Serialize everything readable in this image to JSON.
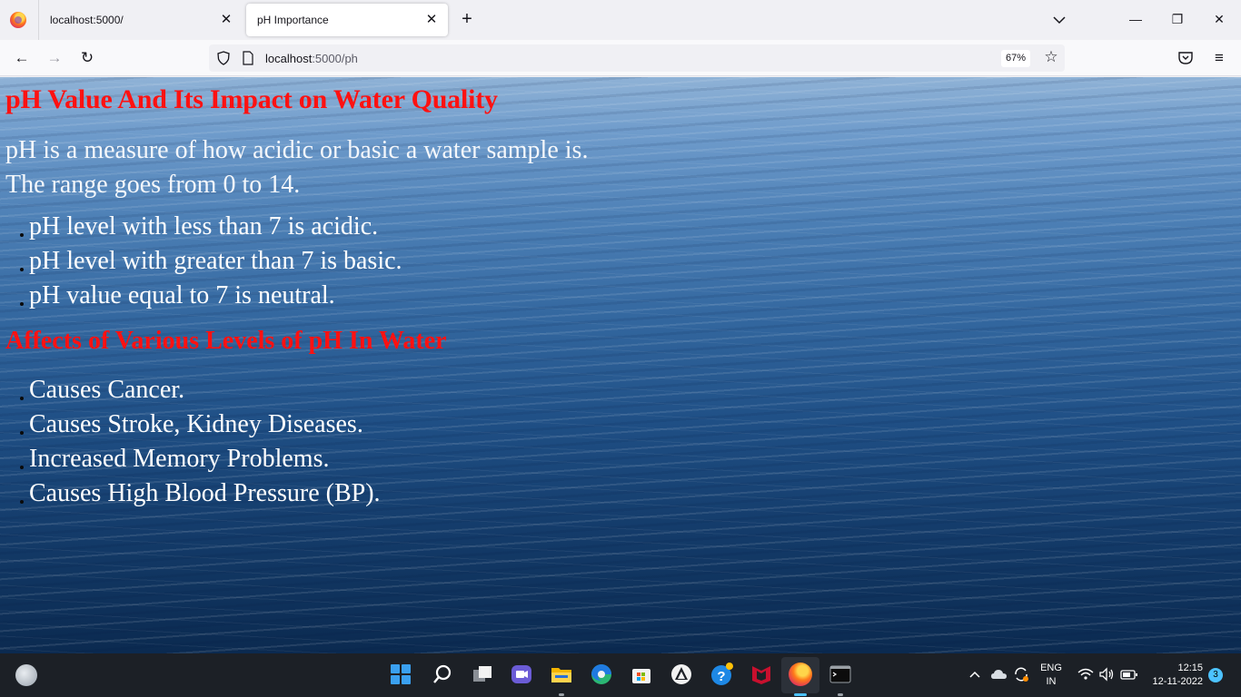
{
  "browser": {
    "tabs": [
      {
        "title": "localhost:5000/",
        "active": false
      },
      {
        "title": "pH Importance",
        "active": true
      }
    ],
    "url": {
      "host": "localhost",
      "path": ":5000/ph"
    },
    "zoom": "67%"
  },
  "page": {
    "heading": "pH Value And Its Impact on Water Quality",
    "intro_line1": "pH is a measure of how acidic or basic a water sample is.",
    "intro_line2": "The range goes from 0 to 14.",
    "ph_levels": [
      "pH level with less than 7 is acidic.",
      "pH level with greater than 7 is basic.",
      "pH value equal to 7 is neutral."
    ],
    "effects_heading": "Affects of Various Levels of pH In Water",
    "effects": [
      "Causes Cancer.",
      "Causes Stroke, Kidney Diseases.",
      "Increased Memory Problems.",
      "Causes High Blood Pressure (BP)."
    ]
  },
  "taskbar": {
    "language": "ENG",
    "region": "IN",
    "time": "12:15",
    "date": "12-11-2022",
    "notifications": "3"
  },
  "colors": {
    "heading": "#ff1111",
    "text": "#ffffff",
    "accent": "#4cc2ff"
  }
}
